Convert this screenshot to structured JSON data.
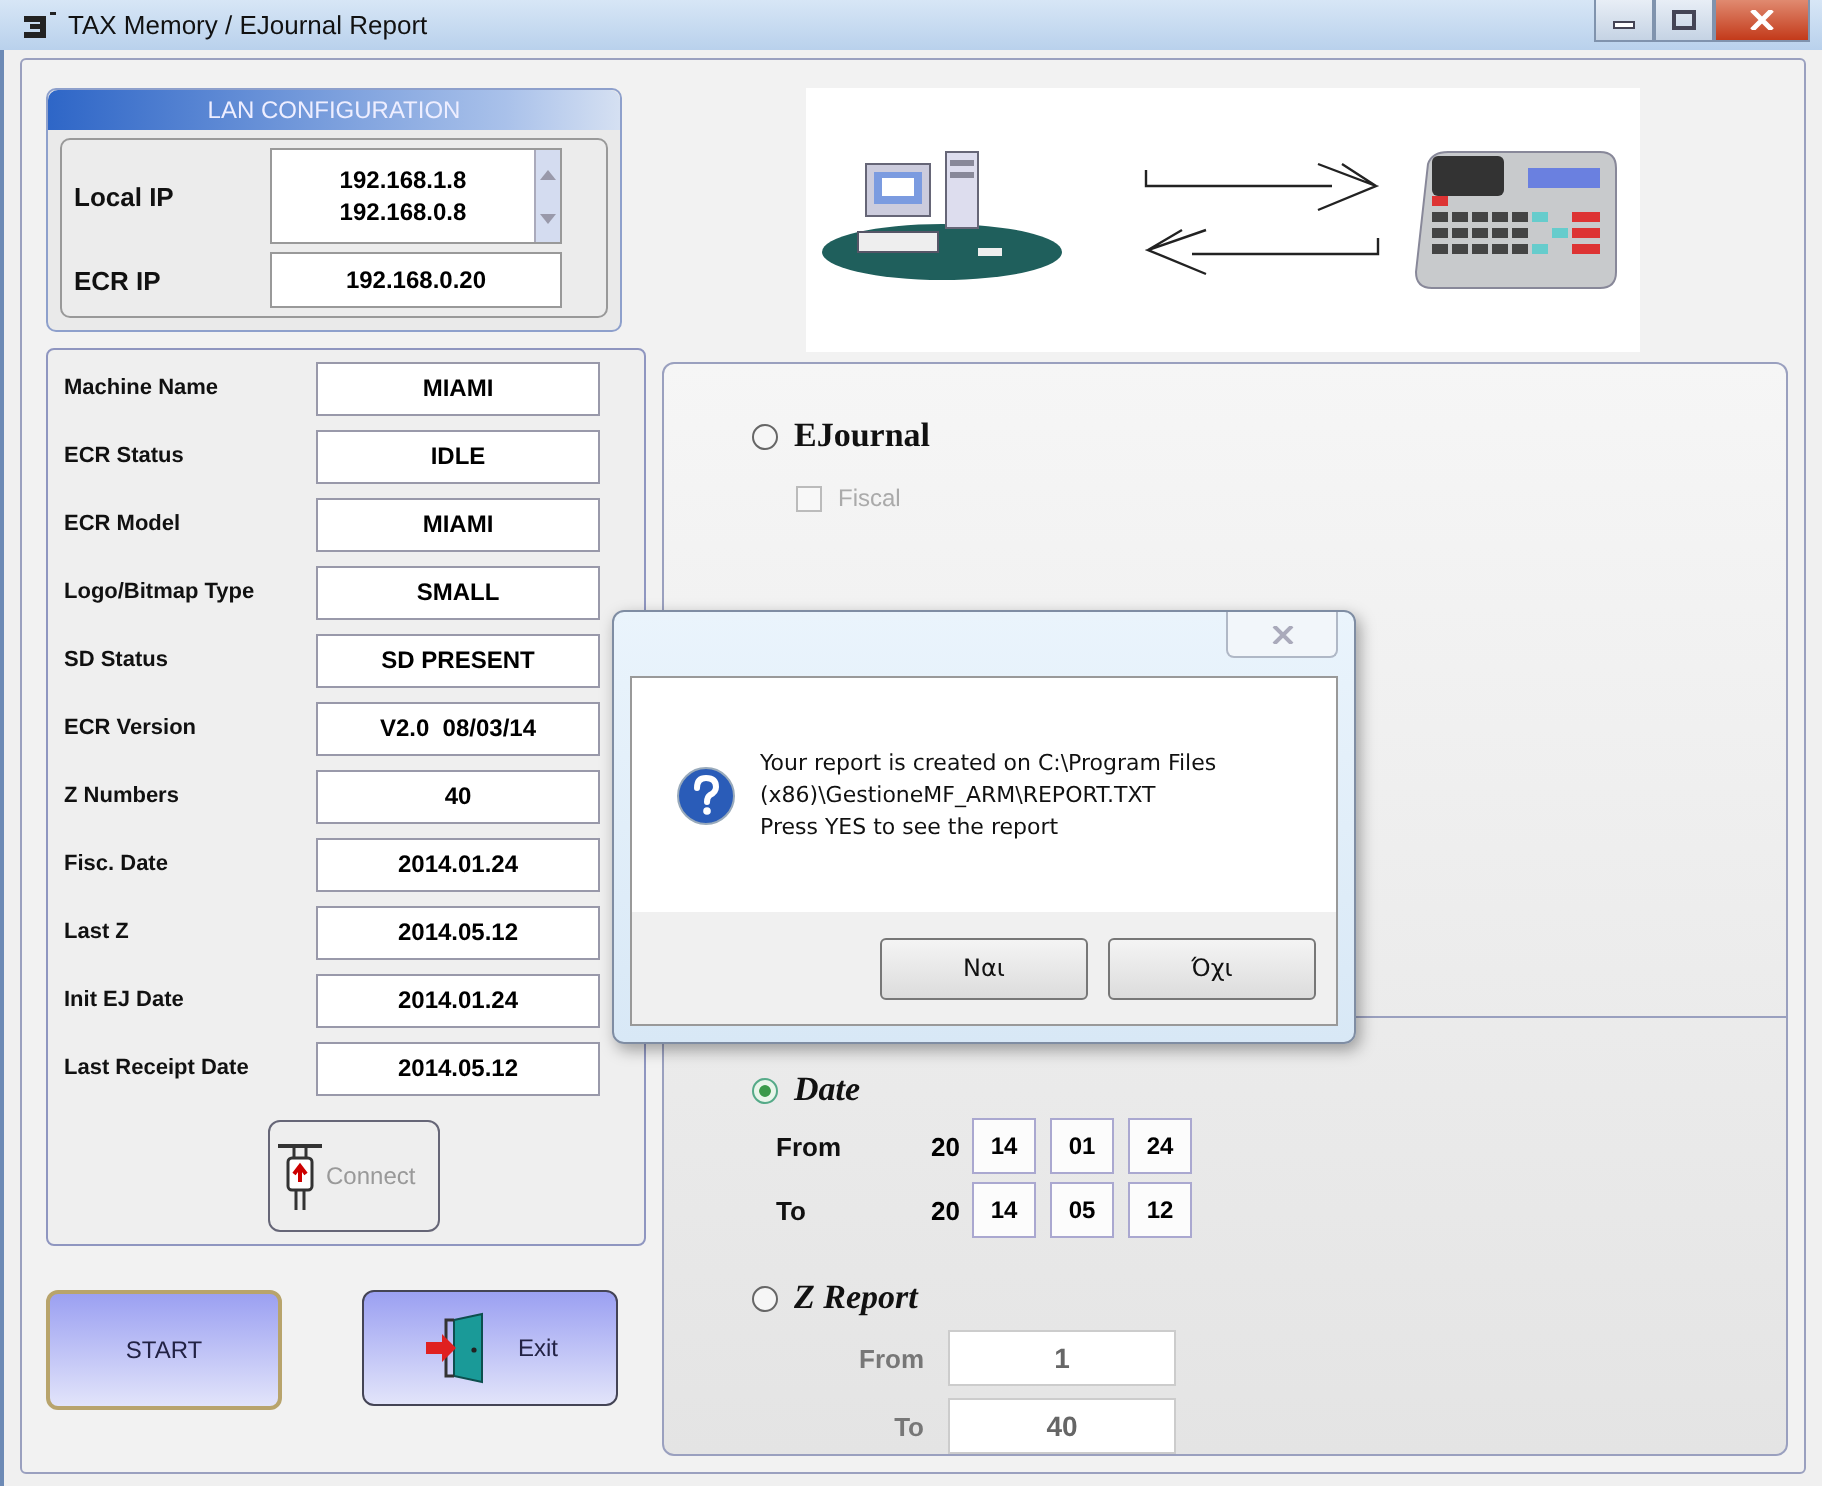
{
  "window": {
    "title": "TAX Memory / EJournal Report"
  },
  "lan_configuration": {
    "title": "LAN CONFIGURATION",
    "local_ip": {
      "label": "Local IP",
      "values": [
        "192.168.1.8",
        "192.168.0.8"
      ]
    },
    "ecr_ip": {
      "label": "ECR IP",
      "value": "192.168.0.20"
    }
  },
  "info_fields": [
    {
      "label": "Machine Name",
      "value": "MIAMI"
    },
    {
      "label": "ECR Status",
      "value": "IDLE"
    },
    {
      "label": "ECR Model",
      "value": "MIAMI"
    },
    {
      "label": "Logo/Bitmap Type",
      "value": "SMALL"
    },
    {
      "label": "SD Status",
      "value": "SD PRESENT"
    },
    {
      "label": "ECR Version",
      "value": "V2.0  08/03/14"
    },
    {
      "label": "Z Numbers",
      "value": "40"
    },
    {
      "label": "Fisc. Date",
      "value": "2014.01.24"
    },
    {
      "label": "Last Z",
      "value": "2014.05.12"
    },
    {
      "label": "Init EJ Date",
      "value": "2014.01.24"
    },
    {
      "label": "Last Receipt Date",
      "value": "2014.05.12"
    }
  ],
  "connect_button": {
    "label": "Connect",
    "disabled": true
  },
  "start_button": {
    "label": "START"
  },
  "exit_button": {
    "label": "Exit"
  },
  "ejournal": {
    "label": "EJournal",
    "selected": false,
    "fiscal": {
      "label": "Fiscal",
      "checked": false,
      "disabled": true
    }
  },
  "date": {
    "label": "Date",
    "selected": true,
    "from": {
      "label": "From",
      "century": "20",
      "parts": [
        "14",
        "01",
        "24"
      ]
    },
    "to": {
      "label": "To",
      "century": "20",
      "parts": [
        "14",
        "05",
        "12"
      ]
    }
  },
  "z_report": {
    "label": "Z Report",
    "selected": false,
    "disabled": true,
    "from": {
      "label": "From",
      "value": "1"
    },
    "to": {
      "label": "To",
      "value": "40"
    }
  },
  "dialog": {
    "message": [
      "Your report is created on C:\\Program Files",
      "(x86)\\GestioneMF_ARM\\REPORT.TXT",
      "Press YES to see the report"
    ],
    "buttons": [
      "Ναι",
      "Όχι"
    ]
  }
}
